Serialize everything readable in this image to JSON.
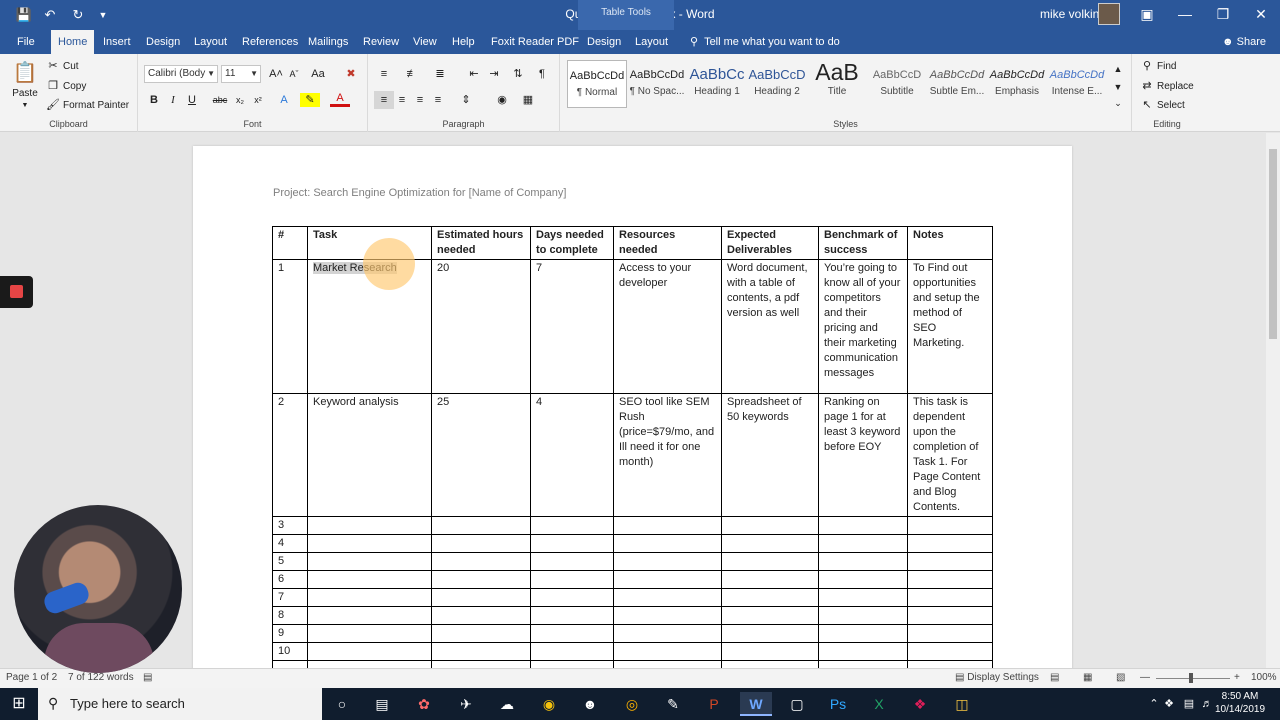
{
  "titlebar": {
    "doc_title": "Quick Proposal.docx  -  Word",
    "table_tools": "Table Tools",
    "user_name": "mike volkin",
    "quick_access": [
      "save-icon",
      "undo-icon",
      "redo-icon",
      "customize-icon"
    ],
    "window_buttons": [
      "ribbon-display-icon",
      "minimize-icon",
      "maximize-icon",
      "close-icon"
    ]
  },
  "ribbon": {
    "tabs": [
      "File",
      "Home",
      "Insert",
      "Design",
      "Layout",
      "References",
      "Mailings",
      "Review",
      "View",
      "Help",
      "Foxit Reader PDF",
      "Design",
      "Layout"
    ],
    "active_tab": "Home",
    "tell_me": "Tell me what you want to do",
    "share": "Share",
    "clipboard": {
      "paste": "Paste",
      "cut": "Cut",
      "copy": "Copy",
      "format_painter": "Format Painter",
      "label": "Clipboard"
    },
    "font": {
      "name": "Calibri (Body",
      "size": "11",
      "label": "Font"
    },
    "paragraph": {
      "label": "Paragraph"
    },
    "styles": {
      "label": "Styles",
      "items": [
        {
          "sample": "AaBbCcDd",
          "name": "¶ Normal"
        },
        {
          "sample": "AaBbCcDd",
          "name": "¶ No Spac..."
        },
        {
          "sample": "AaBbCc",
          "name": "Heading 1"
        },
        {
          "sample": "AaBbCcD",
          "name": "Heading 2"
        },
        {
          "sample": "AaB",
          "name": "Title"
        },
        {
          "sample": "AaBbCcD",
          "name": "Subtitle"
        },
        {
          "sample": "AaBbCcDd",
          "name": "Subtle Em..."
        },
        {
          "sample": "AaBbCcDd",
          "name": "Emphasis"
        },
        {
          "sample": "AaBbCcDd",
          "name": "Intense E..."
        }
      ]
    },
    "editing": {
      "find": "Find",
      "replace": "Replace",
      "select": "Select",
      "label": "Editing"
    }
  },
  "document": {
    "project_line": "Project: Search Engine Optimization for [Name of Company]",
    "table": {
      "headers": [
        "#",
        "Task",
        "Estimated hours needed",
        "Days needed to complete",
        "Resources needed",
        "Expected Deliverables",
        "Benchmark of success",
        "Notes"
      ],
      "rows": [
        [
          "1",
          "Market Research",
          "20",
          "7",
          "Access to your developer",
          "Word document, with a table of contents, a pdf version as well",
          "You’re going to know all of your competitors and their pricing and their marketing communication messages",
          "To Find out opportunities and setup the method of SEO Marketing."
        ],
        [
          "2",
          "Keyword analysis",
          "25",
          "4",
          "SEO tool like SEM Rush (price=$79/mo, and Ill need it for one month)",
          "Spreadsheet of 50 keywords",
          "Ranking on page 1 for at least 3 keyword before EOY",
          "This task is dependent upon the completion of Task 1. For Page Content and Blog Contents."
        ],
        [
          "3",
          "",
          "",
          "",
          "",
          "",
          "",
          ""
        ],
        [
          "4",
          "",
          "",
          "",
          "",
          "",
          "",
          ""
        ],
        [
          "5",
          "",
          "",
          "",
          "",
          "",
          "",
          ""
        ],
        [
          "6",
          "",
          "",
          "",
          "",
          "",
          "",
          ""
        ],
        [
          "7",
          "",
          "",
          "",
          "",
          "",
          "",
          ""
        ],
        [
          "8",
          "",
          "",
          "",
          "",
          "",
          "",
          ""
        ],
        [
          "9",
          "",
          "",
          "",
          "",
          "",
          "",
          ""
        ],
        [
          "10",
          "",
          "",
          "",
          "",
          "",
          "",
          ""
        ],
        [
          "",
          "",
          "",
          "",
          "",
          "",
          "",
          ""
        ],
        [
          "",
          "",
          "",
          "",
          "",
          "",
          "",
          ""
        ]
      ]
    }
  },
  "statusbar": {
    "page": "Page 1 of 2",
    "words": "7 of 122 words",
    "display_settings": "Display Settings",
    "zoom": "100%"
  },
  "taskbar": {
    "search_placeholder": "Type here to search",
    "time": "8:50 AM",
    "date": "10/14/2019"
  }
}
